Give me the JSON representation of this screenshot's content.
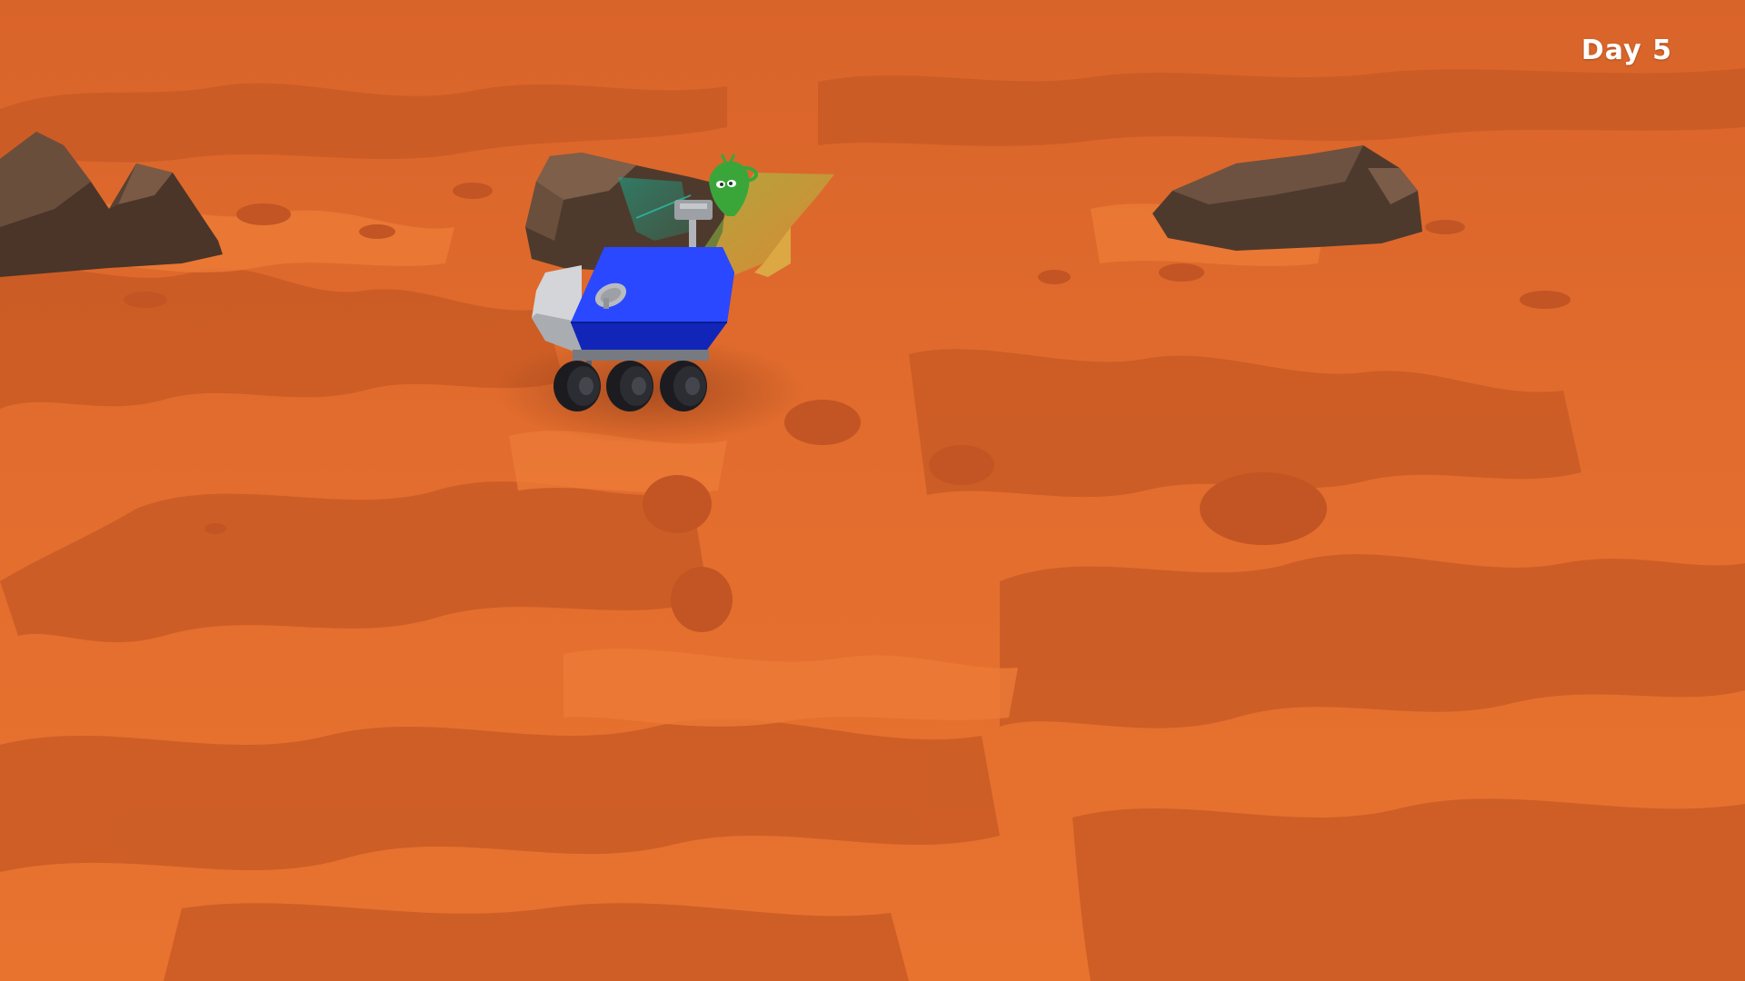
{
  "hud": {
    "day_label": "Day 5"
  },
  "scene": {
    "terrain": "mars-surface",
    "objects": [
      "rock-left-icon",
      "rock-center-icon",
      "rock-right-icon",
      "rover-icon",
      "alien-icon",
      "scan-beam-icon"
    ]
  },
  "colors": {
    "ground": "#e06a2c",
    "ground_dark": "#c65a25",
    "ground_light": "#ec7a36",
    "rover_body": "#1633e8",
    "rover_panel": "#b9bcc1",
    "rock": "#5a4335",
    "alien": "#3aa63a",
    "hud_text": "#ffffff"
  }
}
